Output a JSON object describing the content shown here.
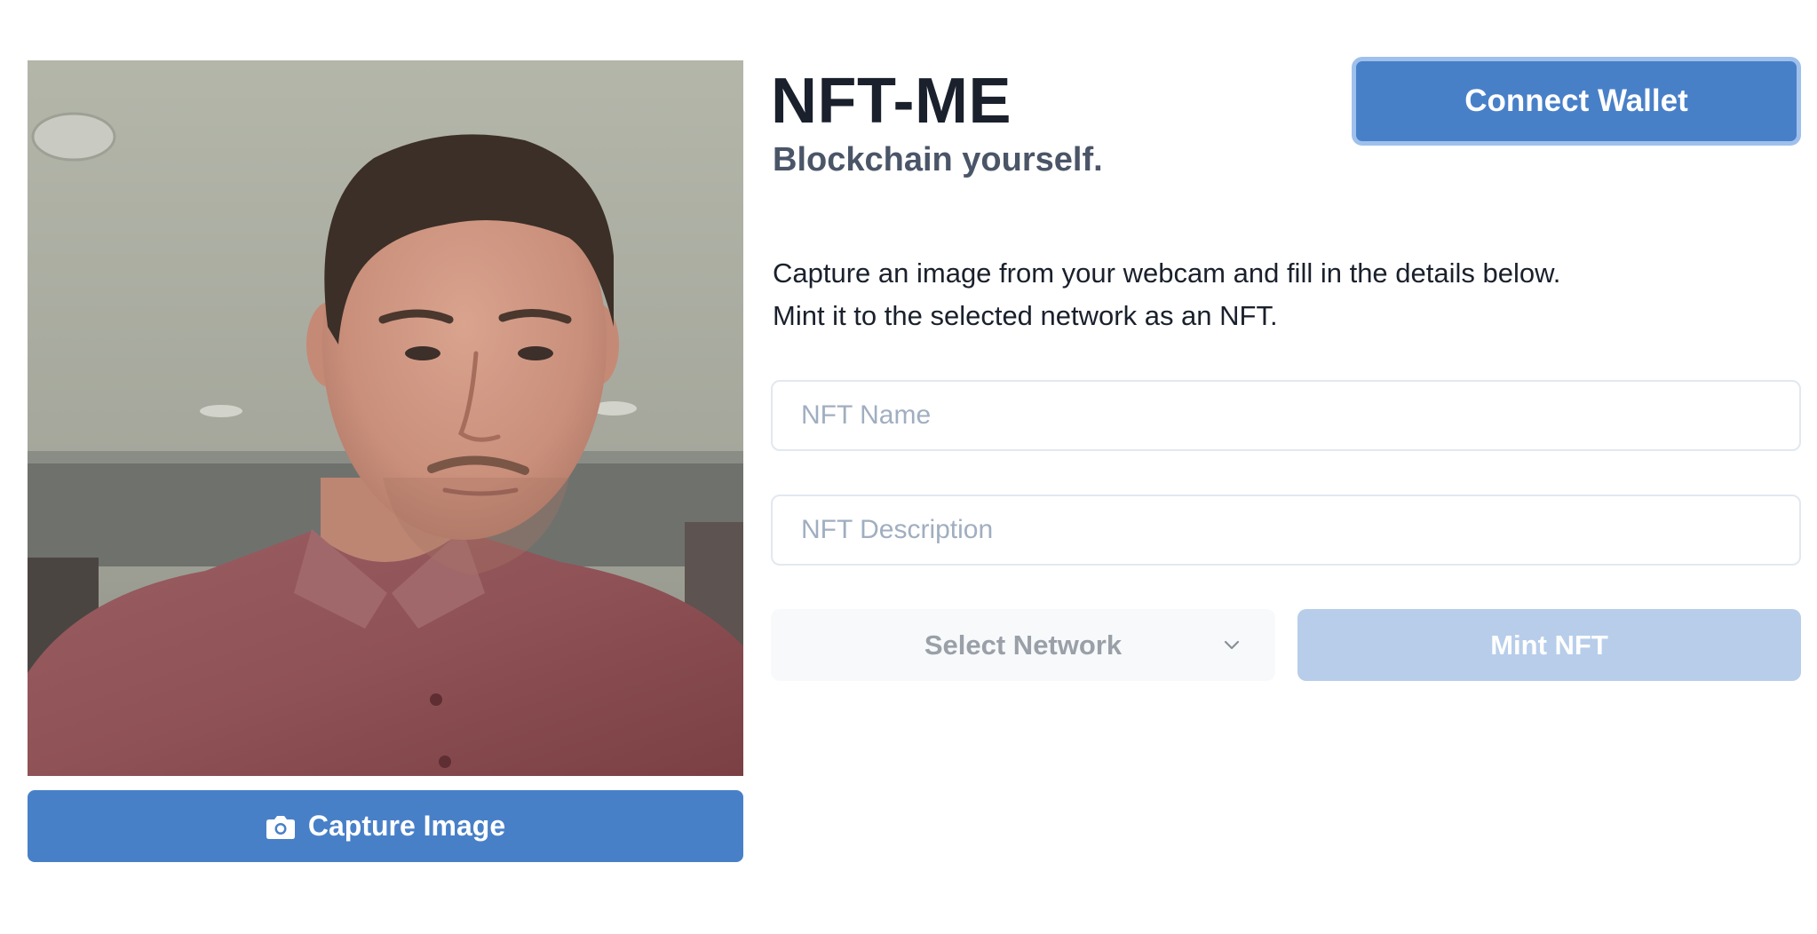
{
  "header": {
    "title": "NFT-ME",
    "subtitle": "Blockchain yourself."
  },
  "wallet": {
    "connect_label": "Connect Wallet"
  },
  "intro": {
    "line1": "Capture an image from your webcam and fill in the details below.",
    "line2": "Mint it to the selected network as an NFT."
  },
  "form": {
    "name_placeholder": "NFT Name",
    "description_placeholder": "NFT Description",
    "network_label": "Select Network",
    "mint_label": "Mint NFT"
  },
  "webcam": {
    "capture_label": "Capture Image",
    "capture_icon": "camera-icon"
  },
  "colors": {
    "primary": "#4880c8",
    "primary_disabled": "#b7cdea",
    "focus_ring": "#9fc0ec",
    "heading": "#1a202c",
    "subheading": "#4a5568",
    "placeholder": "#a0aec0"
  }
}
